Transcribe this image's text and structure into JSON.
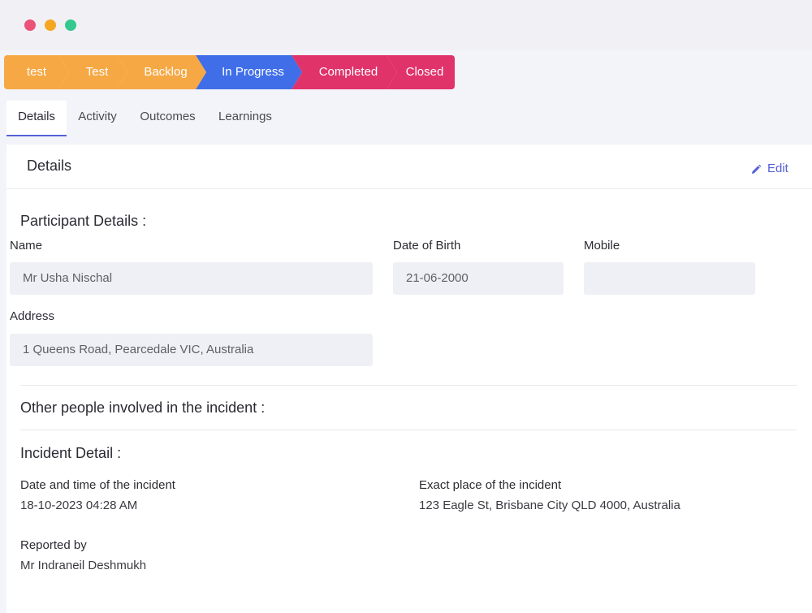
{
  "window": {
    "controls": [
      "close-dot",
      "minimize-dot",
      "maximize-dot"
    ]
  },
  "stages": [
    {
      "label": "test",
      "color": "#f6a844"
    },
    {
      "label": "Test",
      "color": "#f6a844"
    },
    {
      "label": "Backlog",
      "color": "#f6a844"
    },
    {
      "label": "In Progress",
      "color": "#3f6ee8"
    },
    {
      "label": "Completed",
      "color": "#e03369"
    },
    {
      "label": "Closed",
      "color": "#e03369"
    }
  ],
  "tabs": [
    {
      "label": "Details"
    },
    {
      "label": "Activity"
    },
    {
      "label": "Outcomes"
    },
    {
      "label": "Learnings"
    }
  ],
  "panel": {
    "title": "Details",
    "edit_label": "Edit",
    "edit_icon": "pencil-icon"
  },
  "participant": {
    "heading": "Participant Details :",
    "name_label": "Name",
    "name_value": "Mr Usha Nischal",
    "dob_label": "Date of Birth",
    "dob_value": "21-06-2000",
    "mobile_label": "Mobile",
    "mobile_value": "",
    "address_label": "Address",
    "address_value": "1 Queens Road, Pearcedale VIC, Australia"
  },
  "others": {
    "heading": "Other people involved in the incident :"
  },
  "incident": {
    "heading": "Incident Detail :",
    "datetime_label": "Date and time of the incident",
    "datetime_value": "18-10-2023 04:28 AM",
    "place_label": "Exact place of the incident",
    "place_value": "123 Eagle St, Brisbane City QLD 4000, Australia",
    "reported_label": "Reported by",
    "reported_value": "Mr Indraneil Deshmukh"
  },
  "colors": {
    "accent": "#5560d6",
    "stage_orange": "#f6a844",
    "stage_blue": "#3f6ee8",
    "stage_pink": "#e03369",
    "input_bg": "#eef0f5"
  }
}
